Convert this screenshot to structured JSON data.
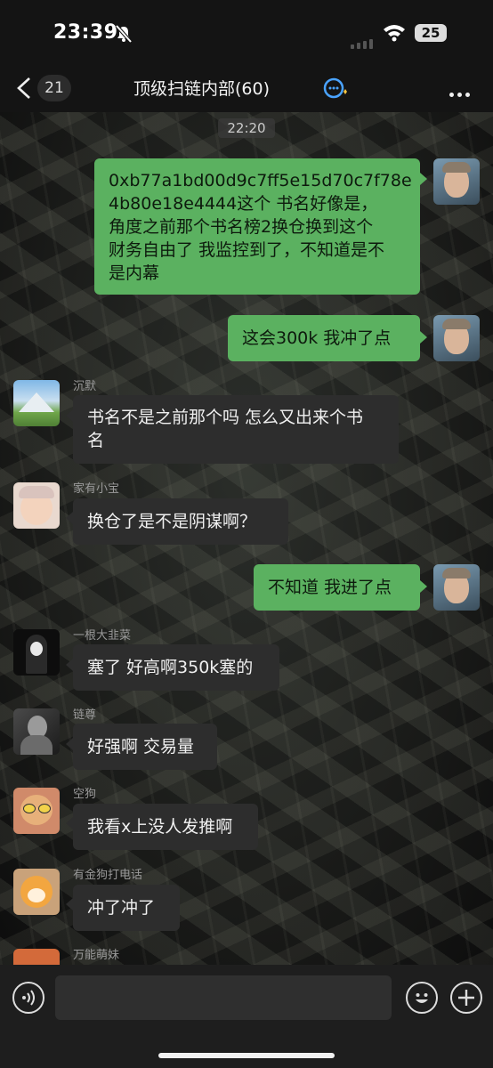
{
  "status_bar": {
    "time": "23:39",
    "battery": "25"
  },
  "nav": {
    "back_count": "21",
    "title": "顶级扫链内部(60)"
  },
  "timestamp": "22:20",
  "messages": [
    {
      "from": "me",
      "lines": [
        "0xb77a1bd00d9c7ff5e15d70c7f78e",
        "4b80e18e4444这个 书名好像是，",
        "角度之前那个书名榜2换仓换到这个",
        "财务自由了 我监控到了，不知道是不",
        "是内幕"
      ]
    },
    {
      "from": "me",
      "lines": [
        "这会300k 我冲了点"
      ]
    },
    {
      "from": "them",
      "nick": "沉默",
      "lines": [
        "书名不是之前那个吗 怎么又出来个书",
        "名"
      ]
    },
    {
      "from": "them",
      "nick": "家有小宝",
      "lines": [
        "换仓了是不是阴谋啊？"
      ]
    },
    {
      "from": "me",
      "lines": [
        "不知道 我进了点"
      ]
    },
    {
      "from": "them",
      "nick": "一根大韭菜",
      "lines": [
        "塞了 好高啊350k塞的"
      ]
    },
    {
      "from": "them",
      "nick": "链尊",
      "lines": [
        "好强啊 交易量"
      ]
    },
    {
      "from": "them",
      "nick": "空狗",
      "lines": [
        "我看x上没人发推啊"
      ]
    },
    {
      "from": "them",
      "nick": "有金狗打电话",
      "lines": [
        "冲了冲了"
      ]
    },
    {
      "from": "them",
      "nick": "万能萌妹",
      "lines": []
    }
  ],
  "colors": {
    "my_bubble": "#5bb160",
    "their_bubble": "#2d2d2d"
  }
}
